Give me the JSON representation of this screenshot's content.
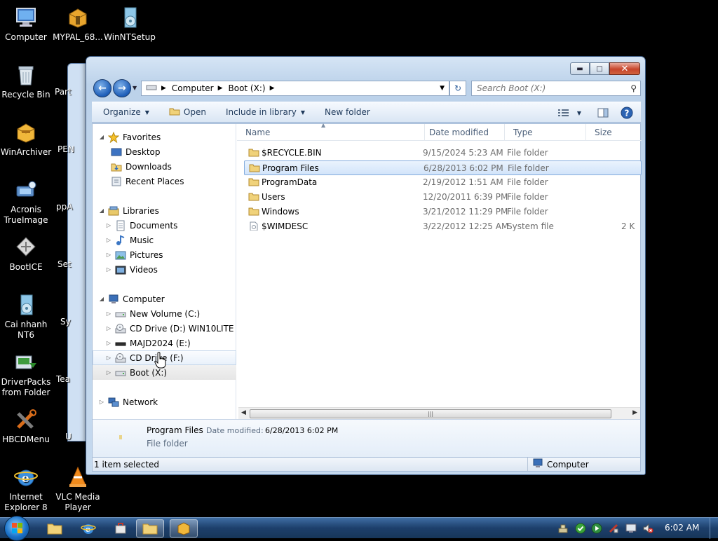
{
  "desktop": {
    "icons": [
      {
        "label": "Computer",
        "icon": "computer-icon"
      },
      {
        "label": "MYPAL_68...",
        "icon": "archive-icon"
      },
      {
        "label": "WinNTSetup",
        "icon": "setup-disc-icon"
      },
      {
        "label": "Recycle Bin",
        "icon": "recycle-bin-icon"
      },
      {
        "label": "WinArchiver",
        "icon": "archive-icon"
      },
      {
        "label": "Acronis TrueImage",
        "icon": "acronis-icon"
      },
      {
        "label": "BootICE",
        "icon": "bootice-icon"
      },
      {
        "label": "Cai nhanh NT6",
        "icon": "setup-disc-icon"
      },
      {
        "label": "DriverPacks from Folder",
        "icon": "driverpacks-icon"
      },
      {
        "label": "HBCDMenu",
        "icon": "tools-icon"
      },
      {
        "label": "Internet Explorer 8",
        "icon": "ie-icon"
      },
      {
        "label": "VLC Media Player",
        "icon": "vlc-icon"
      }
    ],
    "partial_labels": [
      "Part",
      "PEN",
      "ppA",
      "Set",
      "Sy",
      "Tea",
      "U",
      "F"
    ]
  },
  "window": {
    "address": {
      "crumbs": [
        "Computer",
        "Boot (X:)"
      ]
    },
    "search": {
      "placeholder": "Search Boot (X:)"
    },
    "toolbar": {
      "organize": "Organize",
      "open": "Open",
      "include_in_library": "Include in library",
      "new_folder": "New folder"
    },
    "nav": {
      "favorites": "Favorites",
      "desktop": "Desktop",
      "downloads": "Downloads",
      "recent_places": "Recent Places",
      "libraries": "Libraries",
      "documents": "Documents",
      "music": "Music",
      "pictures": "Pictures",
      "videos": "Videos",
      "computer": "Computer",
      "new_volume": "New Volume (C:)",
      "cd_drive_d": "CD Drive (D:) WIN10LITE",
      "majd2024": "MAJD2024 (E:)",
      "cd_drive_f": "CD Drive (F:)",
      "boot_x": "Boot (X:)",
      "network": "Network"
    },
    "columns": {
      "name": "Name",
      "date_modified": "Date modified",
      "type": "Type",
      "size": "Size"
    },
    "files": [
      {
        "name": "$RECYCLE.BIN",
        "date": "9/15/2024 5:23 AM",
        "type": "File folder",
        "size": ""
      },
      {
        "name": "Program Files",
        "date": "6/28/2013 6:02 PM",
        "type": "File folder",
        "size": ""
      },
      {
        "name": "ProgramData",
        "date": "2/19/2012 1:51 AM",
        "type": "File folder",
        "size": ""
      },
      {
        "name": "Users",
        "date": "12/20/2011 6:39 PM",
        "type": "File folder",
        "size": ""
      },
      {
        "name": "Windows",
        "date": "3/21/2012 11:29 PM",
        "type": "File folder",
        "size": ""
      },
      {
        "name": "$WIMDESC",
        "date": "3/22/2012 12:25 AM",
        "type": "System file",
        "size": "2 K"
      }
    ],
    "details": {
      "name": "Program Files",
      "modified_label": "Date modified:",
      "modified_value": "6/28/2013 6:02 PM",
      "type": "File folder"
    },
    "status": {
      "left": "1 item selected",
      "right": "Computer"
    }
  },
  "taskbar": {
    "clock": "6:02 AM"
  }
}
